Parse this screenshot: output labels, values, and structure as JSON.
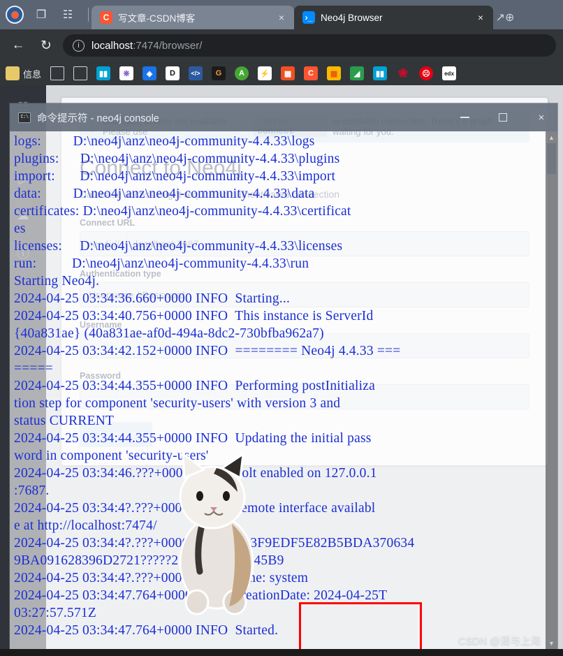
{
  "browser": {
    "window_icons": [
      "mscloud-logo-icon",
      "collections-icon",
      "split-screen-icon"
    ],
    "tabs": [
      {
        "title": "写文章-CSDN博客",
        "favicon_letter": "C",
        "favicon_name": "csdn-favicon",
        "close_label": "×",
        "active": false
      },
      {
        "title": "Neo4j Browser",
        "favicon_letter": "⌫",
        "favicon_name": "neo4j-favicon",
        "close_label": "×",
        "active": true
      }
    ],
    "tab_right_icon": "neo4j-logo-icon",
    "nav": {
      "back_label": "←",
      "reload_label": "↻",
      "info_label": "i",
      "url_host": "localhost",
      "url_path": ":7474/browser/",
      "url_full": "localhost:7474/browser/"
    },
    "bookmarks": [
      {
        "label": "信息",
        "icon": "folder-icon",
        "color": "#e8c96a",
        "glyph": ""
      },
      {
        "label": "",
        "icon": "page-icon",
        "color": "transparent",
        "glyph": "⬜"
      },
      {
        "label": "",
        "icon": "page-icon",
        "color": "transparent",
        "glyph": "⬜"
      },
      {
        "label": "",
        "icon": "bilibili-icon",
        "color": "#00a1d6",
        "glyph": "□"
      },
      {
        "label": "",
        "icon": "zhihu-icon",
        "color": "#ffffff",
        "glyph": "✦"
      },
      {
        "label": "",
        "icon": "csdn-blue-icon",
        "color": "#1a73e8",
        "glyph": "◈"
      },
      {
        "label": "",
        "icon": "docin-icon",
        "color": "#ffffff",
        "glyph": "D"
      },
      {
        "label": "",
        "icon": "code-icon",
        "color": "#2c5aa0",
        "glyph": "‹›"
      },
      {
        "label": "",
        "icon": "gitee-icon",
        "color": "#1b1b1b",
        "glyph": "G"
      },
      {
        "label": "",
        "icon": "anaconda-icon",
        "color": "#44a833",
        "glyph": "A"
      },
      {
        "label": "",
        "icon": "xunlei-icon",
        "color": "#ffffff",
        "glyph": "⚡"
      },
      {
        "label": "",
        "icon": "microsoft-icon",
        "color": "#f25022",
        "glyph": "⊞"
      },
      {
        "label": "",
        "icon": "csdn-icon",
        "color": "#fc5531",
        "glyph": "C"
      },
      {
        "label": "",
        "icon": "office-icon",
        "color": "#ffb900",
        "glyph": "⌗"
      },
      {
        "label": "",
        "icon": "wps-icon",
        "color": "#2a9d4c",
        "glyph": "◧"
      },
      {
        "label": "",
        "icon": "bilibili-icon",
        "color": "#00a1d6",
        "glyph": "□"
      },
      {
        "label": "",
        "icon": "huawei-icon",
        "color": "#cf0a2c",
        "glyph": "❀"
      },
      {
        "label": "",
        "icon": "bugs-icon",
        "color": "#e60012",
        "glyph": "◉"
      },
      {
        "label": "",
        "icon": "edx-icon",
        "color": "#ffffff",
        "glyph": "edx"
      }
    ]
  },
  "neo4j_page": {
    "sidebar_items": [
      "database-icon",
      "star-icon",
      "play-icon",
      "cloud-icon",
      "help-icon"
    ],
    "alert_text_before": "Database access not available. Please use",
    "alert_command": ":server connect",
    "alert_text_after": "to establish connection. There's a graph waiting for you.",
    "heading": "Connect to Neo4j",
    "subtitle": "Database access might require an authenticated connection",
    "connect_url_label": "Connect URL",
    "connect_url_scheme": "neo4j://",
    "connect_url_value": "localhost:7687",
    "auth_type_label": "Authentication type",
    "auth_type_value": "Username / Password",
    "username_label": "Username",
    "username_value": "",
    "password_label": "Password",
    "password_value": "",
    "connect_button": "Connect"
  },
  "console_window": {
    "title": "命令提示符 - neo4j  console",
    "icon": "cmd-prompt-icon",
    "minimize_label": "—",
    "maximize_label": "□",
    "close_label": "×",
    "text": "logs:         D:\\neo4j\\anz\\neo4j-community-4.4.33\\logs\nplugins:      D:\\neo4j\\anz\\neo4j-community-4.4.33\\plugins\nimport:       D:\\neo4j\\anz\\neo4j-community-4.4.33\\import\ndata:         D:\\neo4j\\anz\\neo4j-community-4.4.33\\data\ncertificates: D:\\neo4j\\anz\\neo4j-community-4.4.33\\certificat\nes\nlicenses:     D:\\neo4j\\anz\\neo4j-community-4.4.33\\licenses\nrun:          D:\\neo4j\\anz\\neo4j-community-4.4.33\\run\nStarting Neo4j.\n2024-04-25 03:34:36.660+0000 INFO  Starting...\n2024-04-25 03:34:40.756+0000 INFO  This instance is ServerId\n{40a831ae} (40a831ae-af0d-494a-8dc2-730bfba962a7)\n2024-04-25 03:34:42.152+0000 INFO  ======== Neo4j 4.4.33 ===\n=====\n2024-04-25 03:34:44.355+0000 INFO  Performing postInitializa\ntion step for component 'security-users' with version 3 and\nstatus CURRENT\n2024-04-25 03:34:44.355+0000 INFO  Updating the initial pass\nword in component 'security-users'\n2024-04-25 03:34:46.???+0000 INFO  Bolt enabled on 127.0.0.1\n:7687.\n2024-04-25 03:34:4?.???+0000 INFO  Remote interface availabl\ne at http://localhost:7474/\n2024-04-25 03:34:4?.???+0000 INFO  id: 3F9EDF5E82B5BDA370634\n9BA091628396D2721?????218C4065BE245B9\n2024-04-25 03:34:4?.???+0000 INFO  name: system\n2024-04-25 03:34:47.764+0000 INFO  creationDate: 2024-04-25T\n03:27:57.571Z\n2024-04-25 03:34:47.764+0000 INFO  Started.",
    "highlight_text": "Started.",
    "highlight_color": "#ff0000",
    "scrollbar_up": "▲",
    "scrollbar_down": "▼"
  },
  "overlay": {
    "cat_sticker": "cat-sticker-image",
    "watermark": "CSDN @潇与上海"
  }
}
